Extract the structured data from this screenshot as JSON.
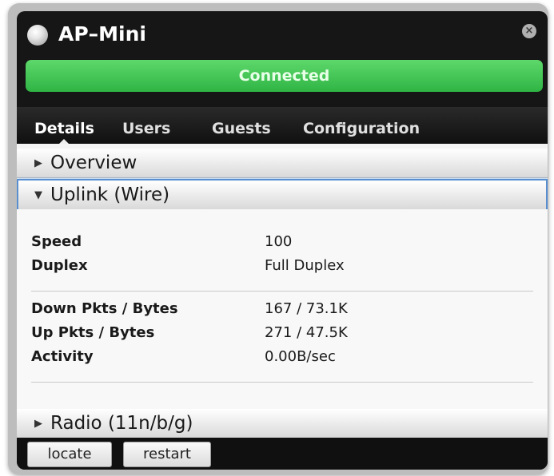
{
  "window": {
    "title": "AP–Mini",
    "close_glyph": "×"
  },
  "status": {
    "label": "Connected",
    "color": "#3cc44f"
  },
  "tabs": [
    {
      "label": "Details",
      "active": true
    },
    {
      "label": "Users",
      "active": false
    },
    {
      "label": "Guests",
      "active": false
    },
    {
      "label": "Configuration",
      "active": false
    }
  ],
  "sections": {
    "overview": {
      "label": "Overview",
      "expanded": false,
      "arrow": "▶"
    },
    "uplink": {
      "label": "Uplink (Wire)",
      "expanded": true,
      "arrow": "▼"
    },
    "radio": {
      "label": "Radio (11n/b/g)",
      "expanded": false,
      "arrow": "▶"
    }
  },
  "uplink_details": {
    "group1": [
      {
        "label": "Speed",
        "value": "100"
      },
      {
        "label": "Duplex",
        "value": "Full Duplex"
      }
    ],
    "group2": [
      {
        "label": "Down Pkts / Bytes",
        "value": "167 / 73.1K"
      },
      {
        "label": "Up Pkts / Bytes",
        "value": "271 / 47.5K"
      },
      {
        "label": "Activity",
        "value": "0.00B/sec"
      }
    ]
  },
  "buttons": {
    "locate": "locate",
    "restart": "restart"
  },
  "icons": {
    "window_dot": "status-dot-icon",
    "close": "close-icon",
    "collapsed_arrow": "triangle-right-icon",
    "expanded_arrow": "triangle-down-icon"
  }
}
